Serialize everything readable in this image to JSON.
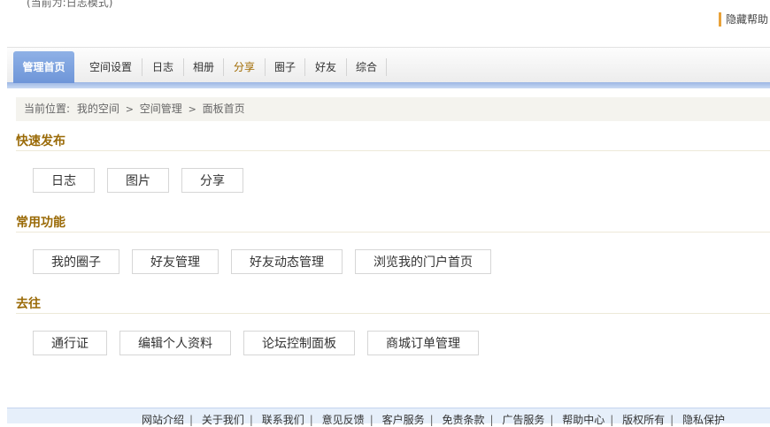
{
  "top": {
    "mode_text": "(当前为:日志模式)",
    "hide_help": "隐藏帮助"
  },
  "tabs": [
    "管理首页",
    "空间设置",
    "日志",
    "相册",
    "分享",
    "圈子",
    "好友",
    "综合"
  ],
  "breadcrumb": {
    "prefix": "当前位置:",
    "items": [
      "我的空间",
      "空间管理",
      "面板首页"
    ]
  },
  "sections": {
    "quick": {
      "title": "快速发布",
      "buttons": [
        "日志",
        "图片",
        "分享"
      ]
    },
    "common": {
      "title": "常用功能",
      "buttons": [
        "我的圈子",
        "好友管理",
        "好友动态管理",
        "浏览我的门户首页"
      ]
    },
    "goto": {
      "title": "去往",
      "buttons": [
        "通行证",
        "编辑个人资料",
        "论坛控制面板",
        "商城订单管理"
      ]
    }
  },
  "footer": {
    "links": [
      "网站介绍",
      "关于我们",
      "联系我们",
      "意见反馈",
      "客户服务",
      "免责条款",
      "广告服务",
      "帮助中心",
      "版权所有",
      "隐私保护"
    ]
  },
  "colors": {
    "section_title": "#9a6a07",
    "tab_active": "#7aa0dd",
    "tab_highlight": "#a06a00",
    "help_bar": "#e8a23a"
  }
}
